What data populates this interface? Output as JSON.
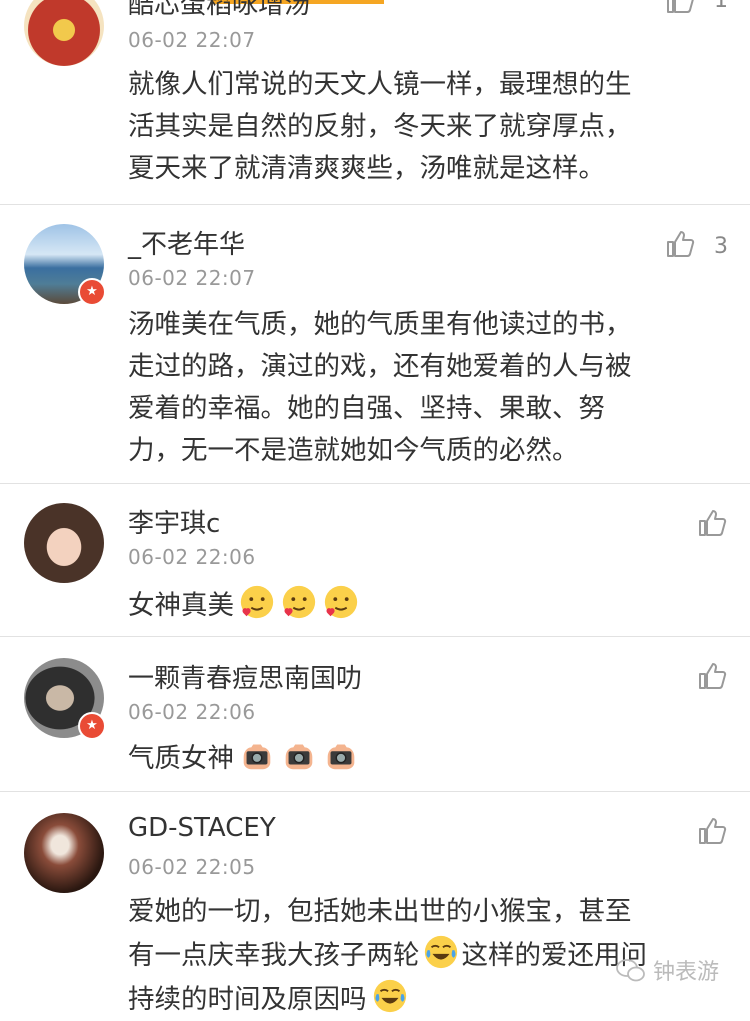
{
  "comments": [
    {
      "username": "酷芯蛋稻咏增汤",
      "time": "06-02 22:07",
      "lines": [
        "就像人们常说的天文人镜一样，最理想的生",
        "活其实是自然的反射，冬天来了就穿厚点，",
        "夏天来了就清清爽爽些，汤唯就是这样。"
      ],
      "likes": "1"
    },
    {
      "username": "_不老年华",
      "time": "06-02 22:07",
      "lines": [
        "汤唯美在气质，她的气质里有他读过的书，",
        "走过的路，演过的戏，还有她爱着的人与被",
        "爱着的幸福。她的自强、坚持、果敢、努",
        "力，无一不是造就她如今气质的必然。"
      ],
      "likes": "3"
    },
    {
      "username": "李宇琪c",
      "time": "06-02 22:06",
      "text": "女神真美",
      "emoji": "love-face"
    },
    {
      "username": "一颗青春痘思南国叻",
      "time": "06-02 22:06",
      "text": "气质女神",
      "emoji": "camera"
    },
    {
      "username": "GD-STACEY",
      "time": "06-02 22:05",
      "line1": "爱她的一切，包括她未出世的小猴宝，甚至",
      "line2": "有一点庆幸我大孩子两轮",
      "line2b": "这样的爱还用问",
      "line3": "持续的时间及原因吗"
    }
  ],
  "watermark": "钟表游",
  "colors": {
    "accent": "#f5a623",
    "verified": "#e94b35",
    "muted": "#999999"
  }
}
